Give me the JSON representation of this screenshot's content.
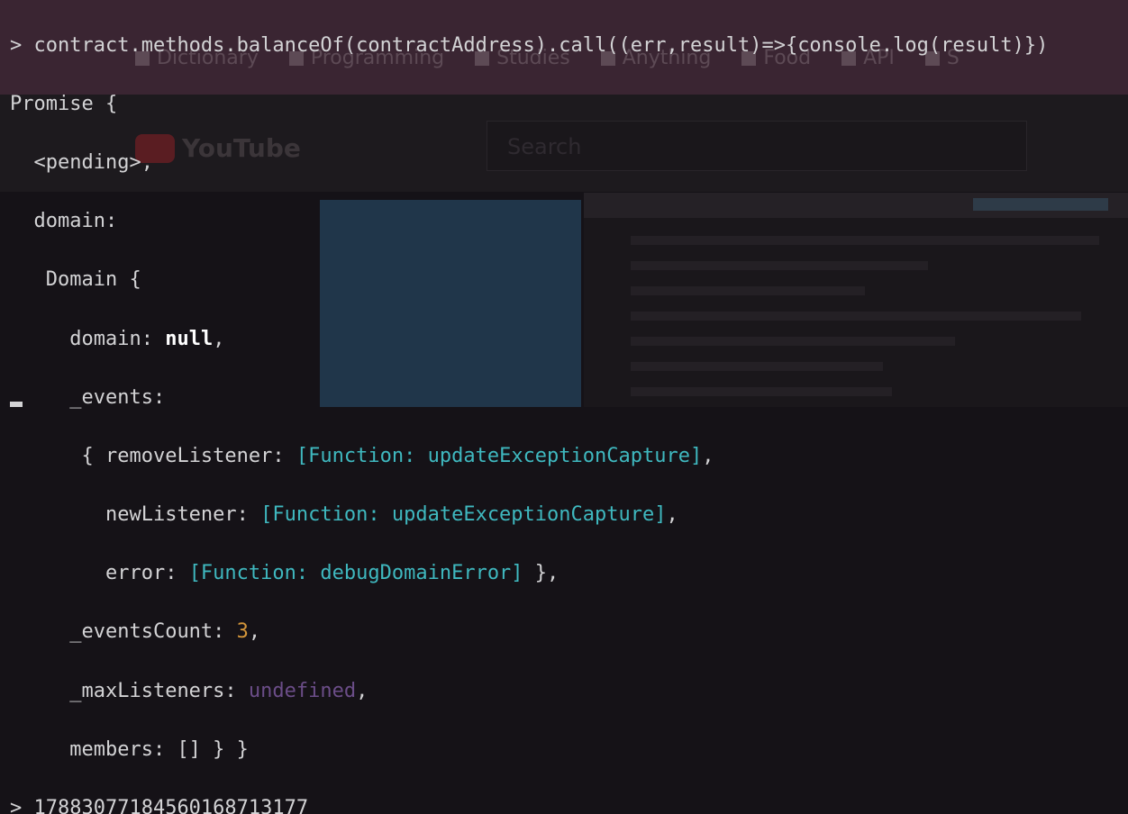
{
  "terminal": {
    "prompt": "> ",
    "command": "contract.methods.balanceOf(contractAddress).call((err,result)=>{console.log(result)})",
    "output": {
      "promise_open": "Promise {",
      "pending": "<pending>,",
      "domain_key": "domain:",
      "domain_obj_open": "Domain {",
      "domain_field_key": "domain: ",
      "domain_field_value": "null",
      "domain_field_trail": ",",
      "events_key": "_events:",
      "remove_listener_prefix": "{ removeListener: ",
      "remove_listener_value": "[Function: updateExceptionCapture]",
      "remove_listener_trail": ",",
      "new_listener_key": "newListener: ",
      "new_listener_value": "[Function: updateExceptionCapture]",
      "new_listener_trail": ",",
      "error_key": "error: ",
      "error_value": "[Function: debugDomainError]",
      "error_trail": " },",
      "events_count_key": "_eventsCount: ",
      "events_count_value": "3",
      "events_count_trail": ",",
      "max_listeners_key": "_maxListeners: ",
      "max_listeners_value": "undefined",
      "max_listeners_trail": ",",
      "members_line": "members: [] } }"
    },
    "result_prompt": "> ",
    "result_value": "178830771845601687131​77"
  },
  "background": {
    "tabs": [
      "Dictionary",
      "Programming",
      "Studies",
      "Anything",
      "Food",
      "API",
      "S"
    ],
    "logo_text": "YouTube",
    "search_placeholder": "Search"
  },
  "colors": {
    "text": "#d3d3d5",
    "null_keyword": "#ffffff",
    "function": "#3fb8bf",
    "number": "#d3953a",
    "undefined": "#6b4d88"
  }
}
